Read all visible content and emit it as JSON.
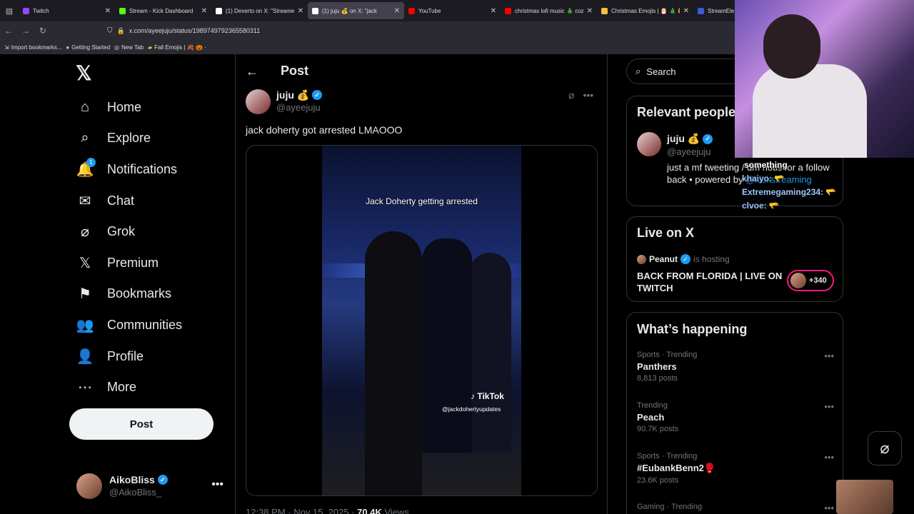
{
  "browser": {
    "tabs": [
      {
        "title": "Twitch",
        "color": "#9146ff",
        "active": false
      },
      {
        "title": "Stream - Kick Dashboard",
        "color": "#53fc18",
        "active": false
      },
      {
        "title": "(1) Dexerto on X: \"Streame",
        "color": "#ffffff",
        "active": false
      },
      {
        "title": "(1) juju 💰 on X: \"jack",
        "color": "#ffffff",
        "active": true
      },
      {
        "title": "YouTube",
        "color": "#ff0000",
        "active": false
      },
      {
        "title": "christmas lofi music 🎄 cozy",
        "color": "#ff0000",
        "active": false
      },
      {
        "title": "Christmas Emojis | 🎅 🎄 🎁",
        "color": "#f0c040",
        "active": false
      },
      {
        "title": "StreamEle",
        "color": "#3b5bdb",
        "active": false
      }
    ],
    "url": "x.com/ayeejuju/status/1989749792365580311",
    "bookmarks": [
      "Import bookmarks...",
      "Getting Started",
      "New Tab",
      "Fall Emojis | 🍂 🎃 ·"
    ]
  },
  "nav": {
    "items": [
      {
        "label": "Home",
        "icon": "home-icon",
        "glyph": "⌂"
      },
      {
        "label": "Explore",
        "icon": "search-icon",
        "glyph": "⌕"
      },
      {
        "label": "Notifications",
        "icon": "bell-icon",
        "glyph": "🔔",
        "badge": "1"
      },
      {
        "label": "Chat",
        "icon": "mail-icon",
        "glyph": "✉"
      },
      {
        "label": "Grok",
        "icon": "grok-icon",
        "glyph": "⌀"
      },
      {
        "label": "Premium",
        "icon": "x-premium-icon",
        "glyph": "𝕏"
      },
      {
        "label": "Bookmarks",
        "icon": "bookmark-icon",
        "glyph": "⚑"
      },
      {
        "label": "Communities",
        "icon": "communities-icon",
        "glyph": "👥"
      },
      {
        "label": "Profile",
        "icon": "profile-icon",
        "glyph": "👤"
      },
      {
        "label": "More",
        "icon": "more-circle-icon",
        "glyph": "⋯"
      }
    ],
    "post_button": "Post",
    "account": {
      "name": "AikoBliss",
      "handle": "@AikoBliss_"
    }
  },
  "main": {
    "header_title": "Post",
    "tweet": {
      "author_name": "juju 💰",
      "author_handle": "@ayeejuju",
      "text": "jack doherty got arrested LMAOOO",
      "video_caption": "Jack Doherty getting arrested",
      "watermark": "TikTok",
      "watermark_handle": "@jackdohertyupdates",
      "time": "12:38 PM · Nov 15, 2025 ·",
      "views": "70.4K",
      "views_label": "Views"
    }
  },
  "right": {
    "search_placeholder": "Search",
    "relevant": {
      "title": "Relevant people",
      "name": "juju 💰",
      "handle": "@ayeejuju",
      "bio": "just a mf tweeting / dm notis for a follow back • powered by",
      "bio_link": "@kickstreaming"
    },
    "live": {
      "title": "Live on X",
      "host": "Peanut",
      "hosting": "is hosting",
      "stream_title": "BACK FROM FLORIDA | LIVE ON TWITCH",
      "count": "+340"
    },
    "happening": {
      "title": "What’s happening",
      "trends": [
        {
          "meta": "Sports · Trending",
          "title": "Panthers",
          "count": "8,813 posts"
        },
        {
          "meta": "Trending",
          "title": "Peach",
          "count": "90.7K posts"
        },
        {
          "meta": "Sports · Trending",
          "title": "#EubankBenn2🥊",
          "count": "23.6K posts"
        },
        {
          "meta": "Gaming · Trending",
          "title": "",
          "count": ""
        }
      ]
    }
  },
  "overlay": {
    "chat": [
      {
        "user": "",
        "text": "something"
      },
      {
        "user": "khaiyo:",
        "text": "🫳"
      },
      {
        "user": "Extremegaming234:",
        "text": "🫳"
      },
      {
        "user": "clvoe:",
        "text": "🫳"
      }
    ]
  }
}
